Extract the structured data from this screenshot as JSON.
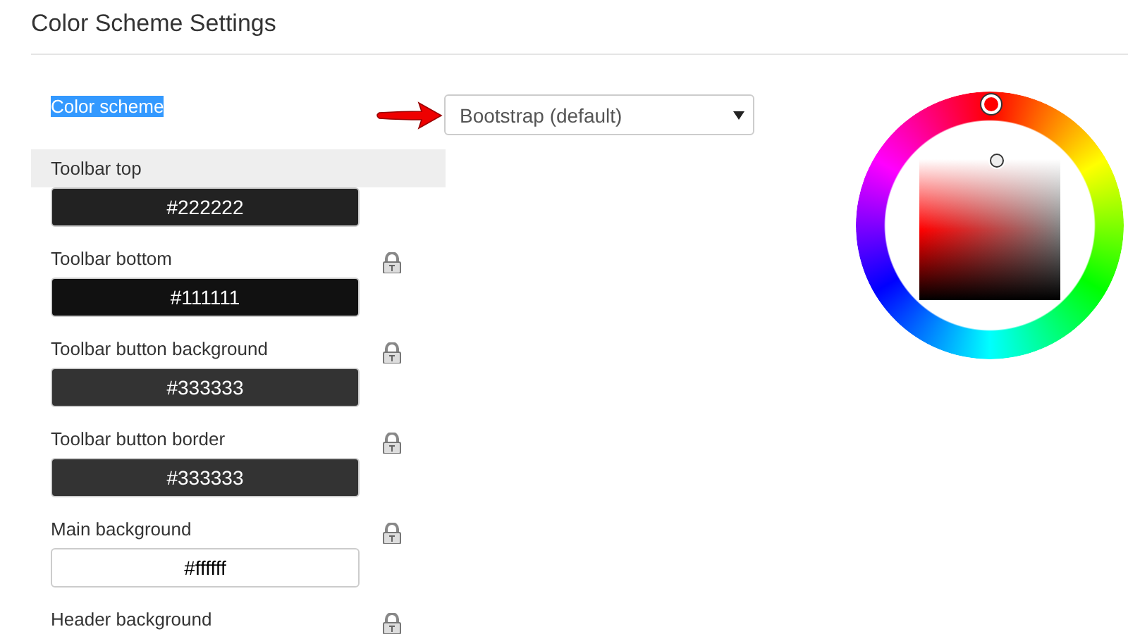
{
  "heading": "Color Scheme Settings",
  "scheme": {
    "label": "Color scheme",
    "label_highlighted": true,
    "value": "Bootstrap (default)"
  },
  "settings": [
    {
      "label": "Toolbar top",
      "value": "#222222",
      "color": "#222222",
      "selected": true,
      "lock": false
    },
    {
      "label": "Toolbar bottom",
      "value": "#111111",
      "color": "#111111",
      "selected": false,
      "lock": true
    },
    {
      "label": "Toolbar button background",
      "value": "#333333",
      "color": "#333333",
      "selected": false,
      "lock": true
    },
    {
      "label": "Toolbar button border",
      "value": "#333333",
      "color": "#333333",
      "selected": false,
      "lock": true
    },
    {
      "label": "Main background",
      "value": "#ffffff",
      "color": "#ffffff",
      "selected": false,
      "lock": true
    },
    {
      "label": "Header background",
      "selected": false,
      "lock": true
    }
  ],
  "picker": {
    "color": "#ff0000"
  }
}
